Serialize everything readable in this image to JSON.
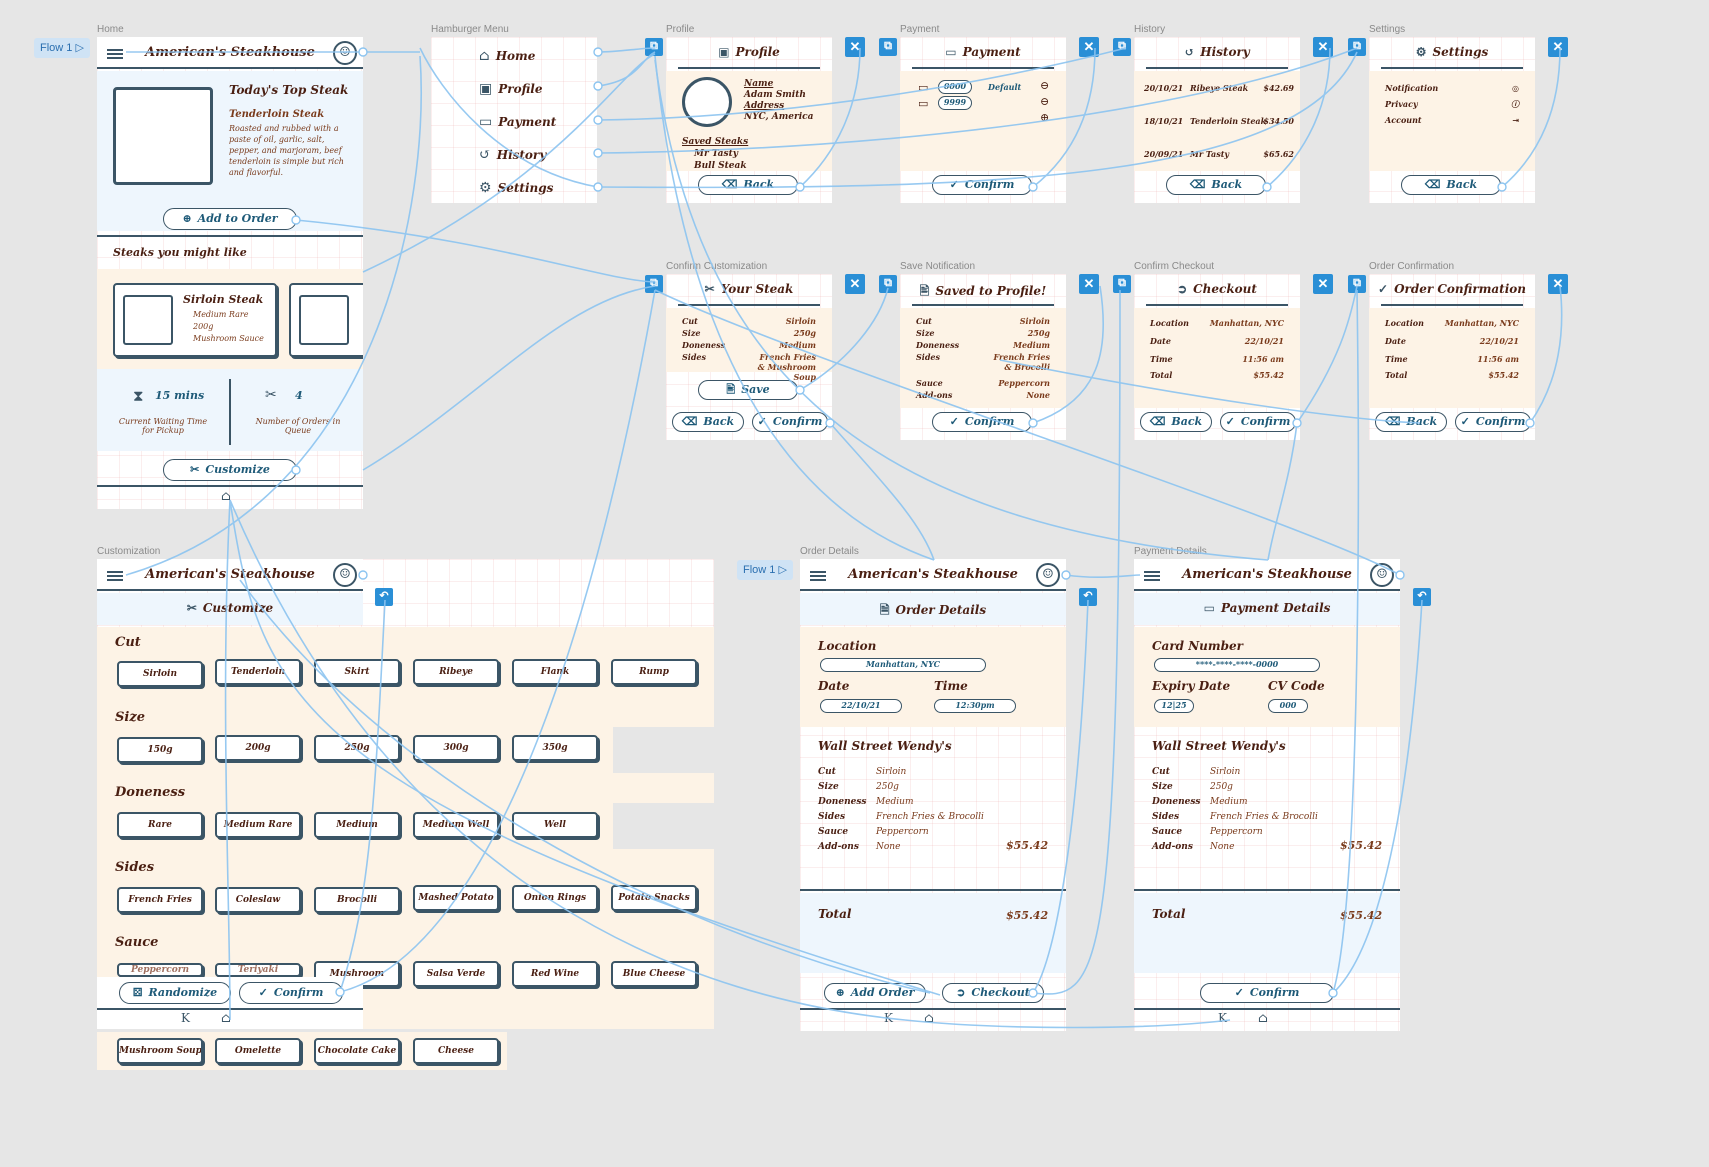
{
  "frames": {
    "home": "Home",
    "hamburger": "Hamburger Menu",
    "profile": "Profile",
    "payment": "Payment",
    "history": "History",
    "settings": "Settings",
    "confirm_custom": "Confirm Customization",
    "save_notif": "Save Notification",
    "confirm_checkout": "Confirm Checkout",
    "order_confirm": "Order Confirmation",
    "customization": "Customization",
    "order_details": "Order Details",
    "payment_details": "Payment Details"
  },
  "flows": {
    "flow1": "Flow 1",
    "flow2": "Flow 1"
  },
  "app_name": "American's Steakhouse",
  "home": {
    "top_title": "Today's Top Steak",
    "top_name": "Tenderloin Steak",
    "top_desc": "Roasted and rubbed with a paste of oil, garlic, salt, pepper, and marjoram, beef tenderloin is simple but rich and flavorful.",
    "add_order": "Add to Order",
    "might_like": "Steaks you might like",
    "card_name": "Sirloin Steak",
    "card_items": [
      "Medium Rare",
      "200g",
      "Mushroom Sauce"
    ],
    "wait_value": "15 mins",
    "wait_label": "Current Waiting Time for Pickup",
    "orders_value": "4",
    "orders_label": "Number of Orders in Queue",
    "customize": "Customize"
  },
  "menu": {
    "items": [
      "Home",
      "Profile",
      "Payment",
      "History",
      "Settings"
    ]
  },
  "profile": {
    "title": "Profile",
    "name_label": "Name",
    "name": "Adam Smith",
    "address_label": "Address",
    "address": "NYC, America",
    "saved_label": "Saved Steaks",
    "saved": [
      "Mr Tasty",
      "Bull Steak"
    ],
    "back": "Back"
  },
  "payment": {
    "title": "Payment",
    "card1": "0000",
    "card2": "9999",
    "default": "Default",
    "confirm": "Confirm"
  },
  "history": {
    "title": "History",
    "rows": [
      [
        "20/10/21",
        "Ribeye Steak",
        "$42.69"
      ],
      [
        "18/10/21",
        "Tenderloin Steak",
        "$34.50"
      ],
      [
        "20/09/21",
        "Mr Tasty",
        "$65.62"
      ]
    ],
    "back": "Back"
  },
  "settings": {
    "title": "Settings",
    "items": [
      "Notification",
      "Privacy",
      "Account"
    ],
    "back": "Back"
  },
  "your_steak": {
    "title": "Your Steak",
    "rows": [
      [
        "Cut",
        "Sirloin"
      ],
      [
        "Size",
        "250g"
      ],
      [
        "Doneness",
        "Medium"
      ],
      [
        "Sides",
        "French Fries & Mushroom Soup"
      ]
    ],
    "save": "Save",
    "back": "Back",
    "confirm": "Confirm"
  },
  "saved": {
    "title": "Saved to Profile!",
    "rows": [
      [
        "Cut",
        "Sirloin"
      ],
      [
        "Size",
        "250g"
      ],
      [
        "Doneness",
        "Medium"
      ],
      [
        "Sides",
        "French Fries & Brocolli"
      ],
      [
        "Sauce",
        "Peppercorn"
      ],
      [
        "Add-ons",
        "None"
      ]
    ],
    "confirm": "Confirm"
  },
  "checkout": {
    "title": "Checkout",
    "rows": [
      [
        "Location",
        "Manhattan, NYC"
      ],
      [
        "Date",
        "22/10/21"
      ],
      [
        "Time",
        "11:56 am"
      ],
      [
        "Total",
        "$55.42"
      ]
    ],
    "back": "Back",
    "confirm": "Confirm"
  },
  "order_conf": {
    "title": "Order Confirmation",
    "rows": [
      [
        "Location",
        "Manhattan, NYC"
      ],
      [
        "Date",
        "22/10/21"
      ],
      [
        "Time",
        "11:56 am"
      ],
      [
        "Total",
        "$55.42"
      ]
    ],
    "back": "Back",
    "confirm": "Confirm"
  },
  "custom": {
    "title": "Customize",
    "sections": [
      {
        "name": "Cut",
        "options": [
          "Sirloin",
          "Tenderloin",
          "Skirt",
          "Ribeye",
          "Flank",
          "Rump"
        ]
      },
      {
        "name": "Size",
        "options": [
          "150g",
          "200g",
          "250g",
          "300g",
          "350g"
        ]
      },
      {
        "name": "Doneness",
        "options": [
          "Rare",
          "Medium Rare",
          "Medium",
          "Medium Well",
          "Well"
        ]
      },
      {
        "name": "Sides",
        "options": [
          "French Fries",
          "Coleslaw",
          "Brocolli",
          "Mashed Potato",
          "Onion Rings",
          "Potato Snacks"
        ]
      },
      {
        "name": "Sauce",
        "options": [
          "Peppercorn",
          "Teriyaki",
          "Mushroom",
          "Salsa Verde",
          "Red Wine",
          "Blue Cheese"
        ]
      }
    ],
    "extra": [
      "Mushroom Soup",
      "Omelette",
      "Chocolate Cake",
      "Cheese"
    ],
    "randomize": "Randomize",
    "confirm": "Confirm"
  },
  "order_details": {
    "title": "Order Details",
    "location_label": "Location",
    "location": "Manhattan, NYC",
    "date_label": "Date",
    "date": "22/10/21",
    "time_label": "Time",
    "time": "12:30pm",
    "store": "Wall Street Wendy's",
    "rows": [
      [
        "Cut",
        "Sirloin"
      ],
      [
        "Size",
        "250g"
      ],
      [
        "Doneness",
        "Medium"
      ],
      [
        "Sides",
        "French Fries & Brocolli"
      ],
      [
        "Sauce",
        "Peppercorn"
      ],
      [
        "Add-ons",
        "None"
      ]
    ],
    "subtotal": "$55.42",
    "total_label": "Total",
    "total": "$55.42",
    "add_order": "Add Order",
    "checkout": "Checkout"
  },
  "payment_details": {
    "title": "Payment Details",
    "card_label": "Card Number",
    "card": "****-****-****-0000",
    "expiry_label": "Expiry Date",
    "expiry": "12|25",
    "cv_label": "CV Code",
    "cv": "000",
    "store": "Wall Street Wendy's",
    "rows": [
      [
        "Cut",
        "Sirloin"
      ],
      [
        "Size",
        "250g"
      ],
      [
        "Doneness",
        "Medium"
      ],
      [
        "Sides",
        "French Fries & Brocolli"
      ],
      [
        "Sauce",
        "Peppercorn"
      ],
      [
        "Add-ons",
        "None"
      ]
    ],
    "subtotal": "$55.42",
    "total_label": "Total",
    "total": "$55.42",
    "confirm": "Confirm"
  },
  "colors": {
    "accent": "#2a8fd6",
    "brown": "#4a1f12",
    "outline": "#3b5566",
    "cream": "#fdf3e6",
    "pale_blue": "#eef6fd"
  }
}
